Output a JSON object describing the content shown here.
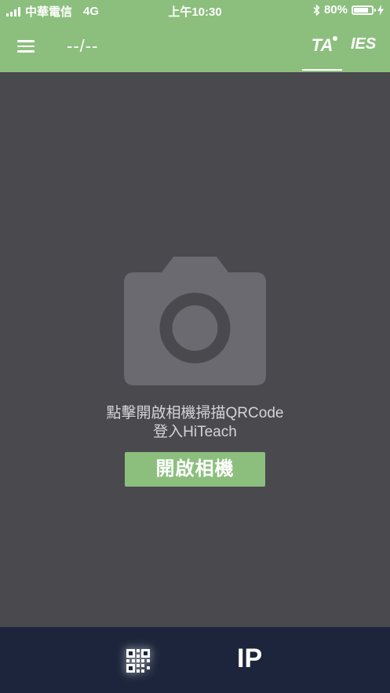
{
  "status_bar": {
    "carrier": "中華電信",
    "network": "4G",
    "time": "上午10:30",
    "battery": "80%",
    "battery_level": 0.8
  },
  "nav": {
    "date": "--/--",
    "tabs": [
      {
        "label": "TA",
        "active": true
      },
      {
        "label": "IES",
        "active": false
      }
    ],
    "menu_icon": "hamburger-icon"
  },
  "main": {
    "camera_icon": "camera-icon",
    "prompt_line1": "點擊開啟相機掃描QRCode",
    "prompt_line2": "登入HiTeach",
    "open_camera_button": "開啟相機"
  },
  "bottom_bar": {
    "qr_icon": "qrcode-icon",
    "ip_label": "IP"
  },
  "colors": {
    "header_green": "#8cbf7e",
    "background": "#4a494e",
    "bottom_bar": "#1c253b",
    "camera_gray": "#6b6a70"
  }
}
